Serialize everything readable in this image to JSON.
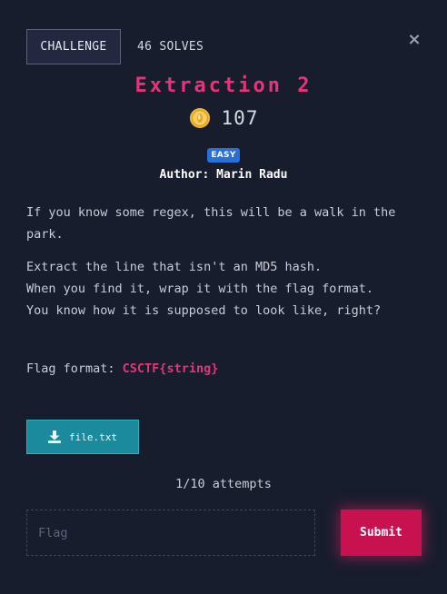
{
  "header": {
    "tab_label": "CHALLENGE",
    "solves_label": "46 SOLVES",
    "close_symbol": "×"
  },
  "challenge": {
    "title": "Extraction 2",
    "points": "107",
    "difficulty": "EASY",
    "author": "Author: Marin Radu"
  },
  "description": {
    "paragraph_1": "If you know some regex, this will be a walk in the park.",
    "paragraph_2_line_1": "Extract the line that isn't an MD5 hash.",
    "paragraph_2_line_2": "When you find it, wrap it with the flag format.",
    "paragraph_2_line_3": "You know how it is supposed to look like, right?"
  },
  "flag_format": {
    "label": "Flag format: ",
    "value": "CSCTF{string}"
  },
  "file": {
    "name": "file.txt",
    "icon": "download-icon"
  },
  "attempts": {
    "text": "1/10 attempts"
  },
  "submission": {
    "placeholder": "Flag",
    "value": "",
    "submit_label": "Submit"
  },
  "colors": {
    "background": "#181d2e",
    "accent_pink": "#e8337a",
    "submit_red": "#c8124f",
    "file_teal": "#1a8a9c",
    "badge_blue": "#2a6fd6",
    "coin_gold": "#f0b93a"
  }
}
